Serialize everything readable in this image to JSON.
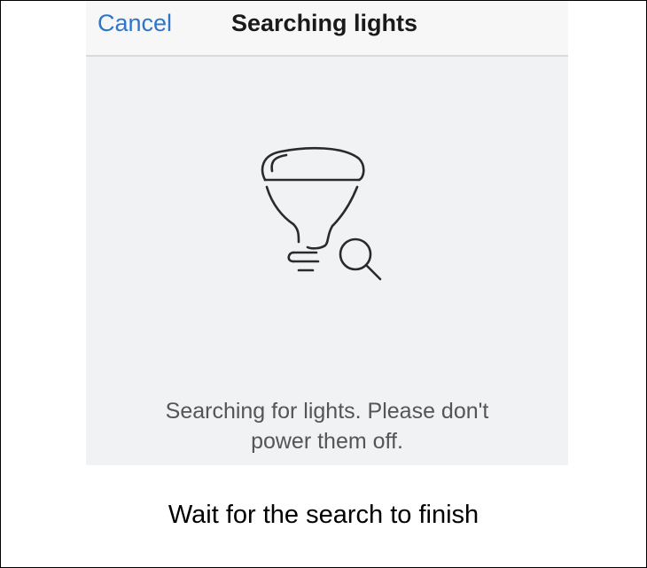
{
  "navbar": {
    "cancel_label": "Cancel",
    "title": "Searching lights"
  },
  "illustration": {
    "icon": "bulb-search-icon"
  },
  "status": {
    "line1": "Searching for lights. Please don't",
    "line2": "power them off."
  },
  "caption": "Wait for the search to finish",
  "colors": {
    "accent": "#2f76c7",
    "screen_background": "#f1f2f4",
    "navbar_background": "#f7f7f8",
    "status_text": "#555555"
  }
}
